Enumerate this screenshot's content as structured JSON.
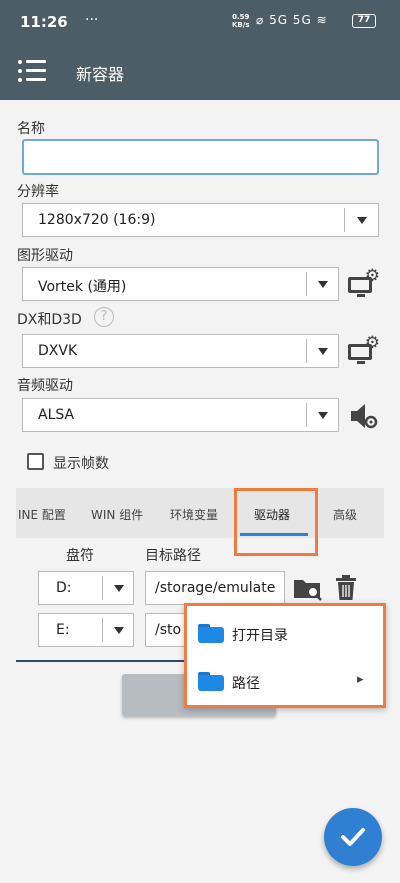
{
  "status": {
    "time": "11:26",
    "dots": "···",
    "speed_top": "0.59",
    "speed_bottom": "KB/s",
    "signal": "5G 5G",
    "battery": "77"
  },
  "appbar": {
    "title": "新容器"
  },
  "form": {
    "name_label": "名称",
    "name_value": "",
    "resolution_label": "分辨率",
    "resolution_value": "1280x720 (16:9)",
    "graphics_label": "图形驱动",
    "graphics_value": "Vortek (通用)",
    "dx_label": "DX和D3D",
    "dx_help": "?",
    "dx_value": "DXVK",
    "audio_label": "音频驱动",
    "audio_value": "ALSA",
    "show_fps_label": "显示帧数",
    "show_fps_checked": false
  },
  "tabs": [
    "INE 配置",
    "WIN 组件",
    "环境变量",
    "驱动器",
    "高级"
  ],
  "active_tab": "驱动器",
  "drives": {
    "letter_header": "盘符",
    "path_header": "目标路径",
    "rows": [
      {
        "letter": "D:",
        "path": "/storage/emulate"
      },
      {
        "letter": "E:",
        "path": "/sto"
      }
    ]
  },
  "popup": {
    "items": [
      {
        "label": "打开目录",
        "icon": "folder-icon"
      },
      {
        "label": "路径",
        "icon": "folder-icon",
        "submenu": "▸"
      }
    ]
  },
  "colors": {
    "appbar": "#4d5d68",
    "accent": "#f07b3e",
    "fab": "#2f7fd2"
  }
}
